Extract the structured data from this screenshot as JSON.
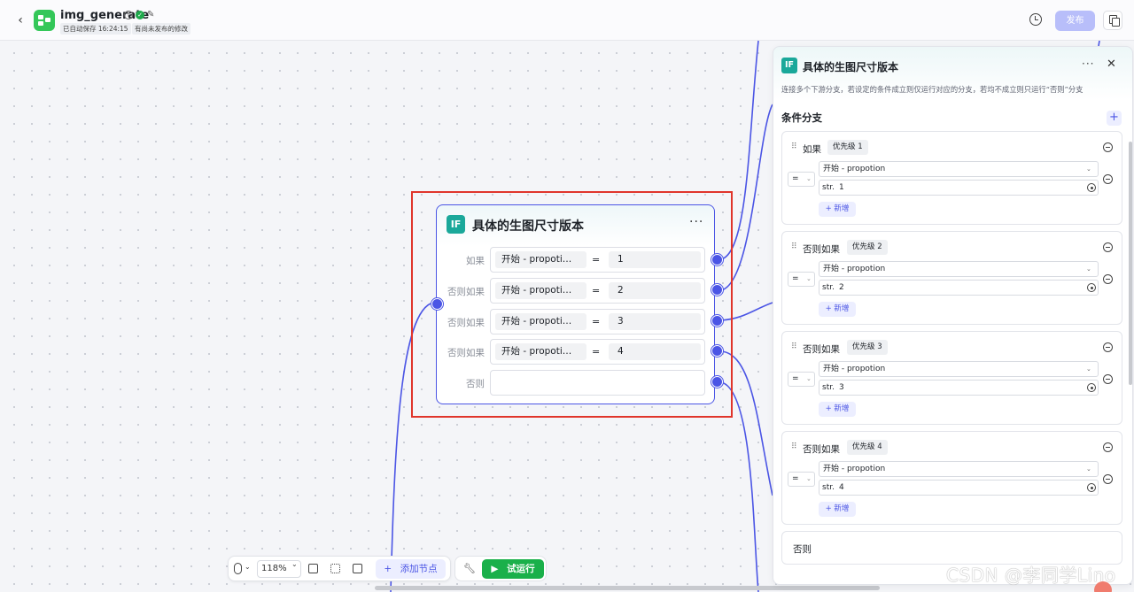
{
  "topbar": {
    "app_name": "img_generate",
    "save_status": "已自动保存 16:24:15",
    "unpublished_status": "有尚未发布的修改",
    "publish_label": "发布"
  },
  "node": {
    "icon_text": "IF",
    "title": "具体的生图尺寸版本",
    "more": "···",
    "conditions": [
      {
        "label": "如果",
        "var": "开始 - propoti…",
        "op": "=",
        "value": "1"
      },
      {
        "label": "否则如果",
        "var": "开始 - propoti…",
        "op": "=",
        "value": "2"
      },
      {
        "label": "否则如果",
        "var": "开始 - propoti…",
        "op": "=",
        "value": "3"
      },
      {
        "label": "否则如果",
        "var": "开始 - propoti…",
        "op": "=",
        "value": "4"
      }
    ],
    "else_label": "否则"
  },
  "toolbar": {
    "zoom": "118%",
    "add_node": "添加节点",
    "add_node_prefix": "+",
    "run": "试运行"
  },
  "panel": {
    "icon_text": "IF",
    "title": "具体的生图尺寸版本",
    "more": "···",
    "close": "✕",
    "description": "连接多个下游分支，若设定的条件成立则仅运行对应的分支，若均不成立则只运行“否则”分支",
    "section_title": "条件分支",
    "add_symbol": "+",
    "branches": [
      {
        "label": "如果",
        "priority": "优先级 1",
        "op": "=",
        "var": "开始 - propotion",
        "type": "str.",
        "value": "1",
        "new_label": "+ 新增"
      },
      {
        "label": "否则如果",
        "priority": "优先级 2",
        "op": "=",
        "var": "开始 - propotion",
        "type": "str.",
        "value": "2",
        "new_label": "+ 新增"
      },
      {
        "label": "否则如果",
        "priority": "优先级 3",
        "op": "=",
        "var": "开始 - propotion",
        "type": "str.",
        "value": "3",
        "new_label": "+ 新增"
      },
      {
        "label": "否则如果",
        "priority": "优先级 4",
        "op": "=",
        "var": "开始 - propotion",
        "type": "str.",
        "value": "4",
        "new_label": "+ 新增"
      }
    ],
    "else_label": "否则"
  },
  "watermark": "CSDN @李同学Lino",
  "colors": {
    "accent": "#4b55e5",
    "if_icon": "#1aa89a",
    "run_button": "#1ab04a",
    "selection_box": "#e0352b",
    "publish_disabled": "#b8befa"
  }
}
